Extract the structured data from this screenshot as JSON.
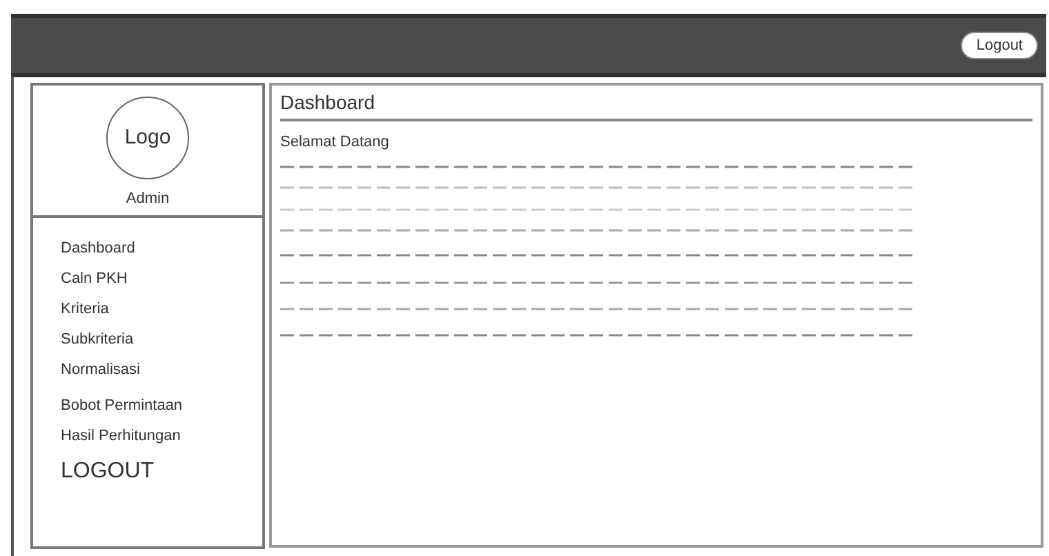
{
  "header": {
    "logout_button": "Logout"
  },
  "sidebar": {
    "logo": "Logo",
    "user": "Admin",
    "menu": [
      {
        "label": "Dashboard",
        "kind": "link"
      },
      {
        "label": "Caln PKH",
        "kind": "link"
      },
      {
        "label": "Kriteria",
        "kind": "link"
      },
      {
        "label": "Subkriteria",
        "kind": "link"
      },
      {
        "label": "Normalisasi",
        "kind": "link"
      },
      {
        "label": "Bobot Permintaan",
        "kind": "link"
      },
      {
        "label": "Hasil Perhitungan",
        "kind": "link"
      },
      {
        "label": "LOGOUT",
        "kind": "large"
      }
    ]
  },
  "content": {
    "title": "Dashboard",
    "greeting": "Selamat Datang"
  }
}
